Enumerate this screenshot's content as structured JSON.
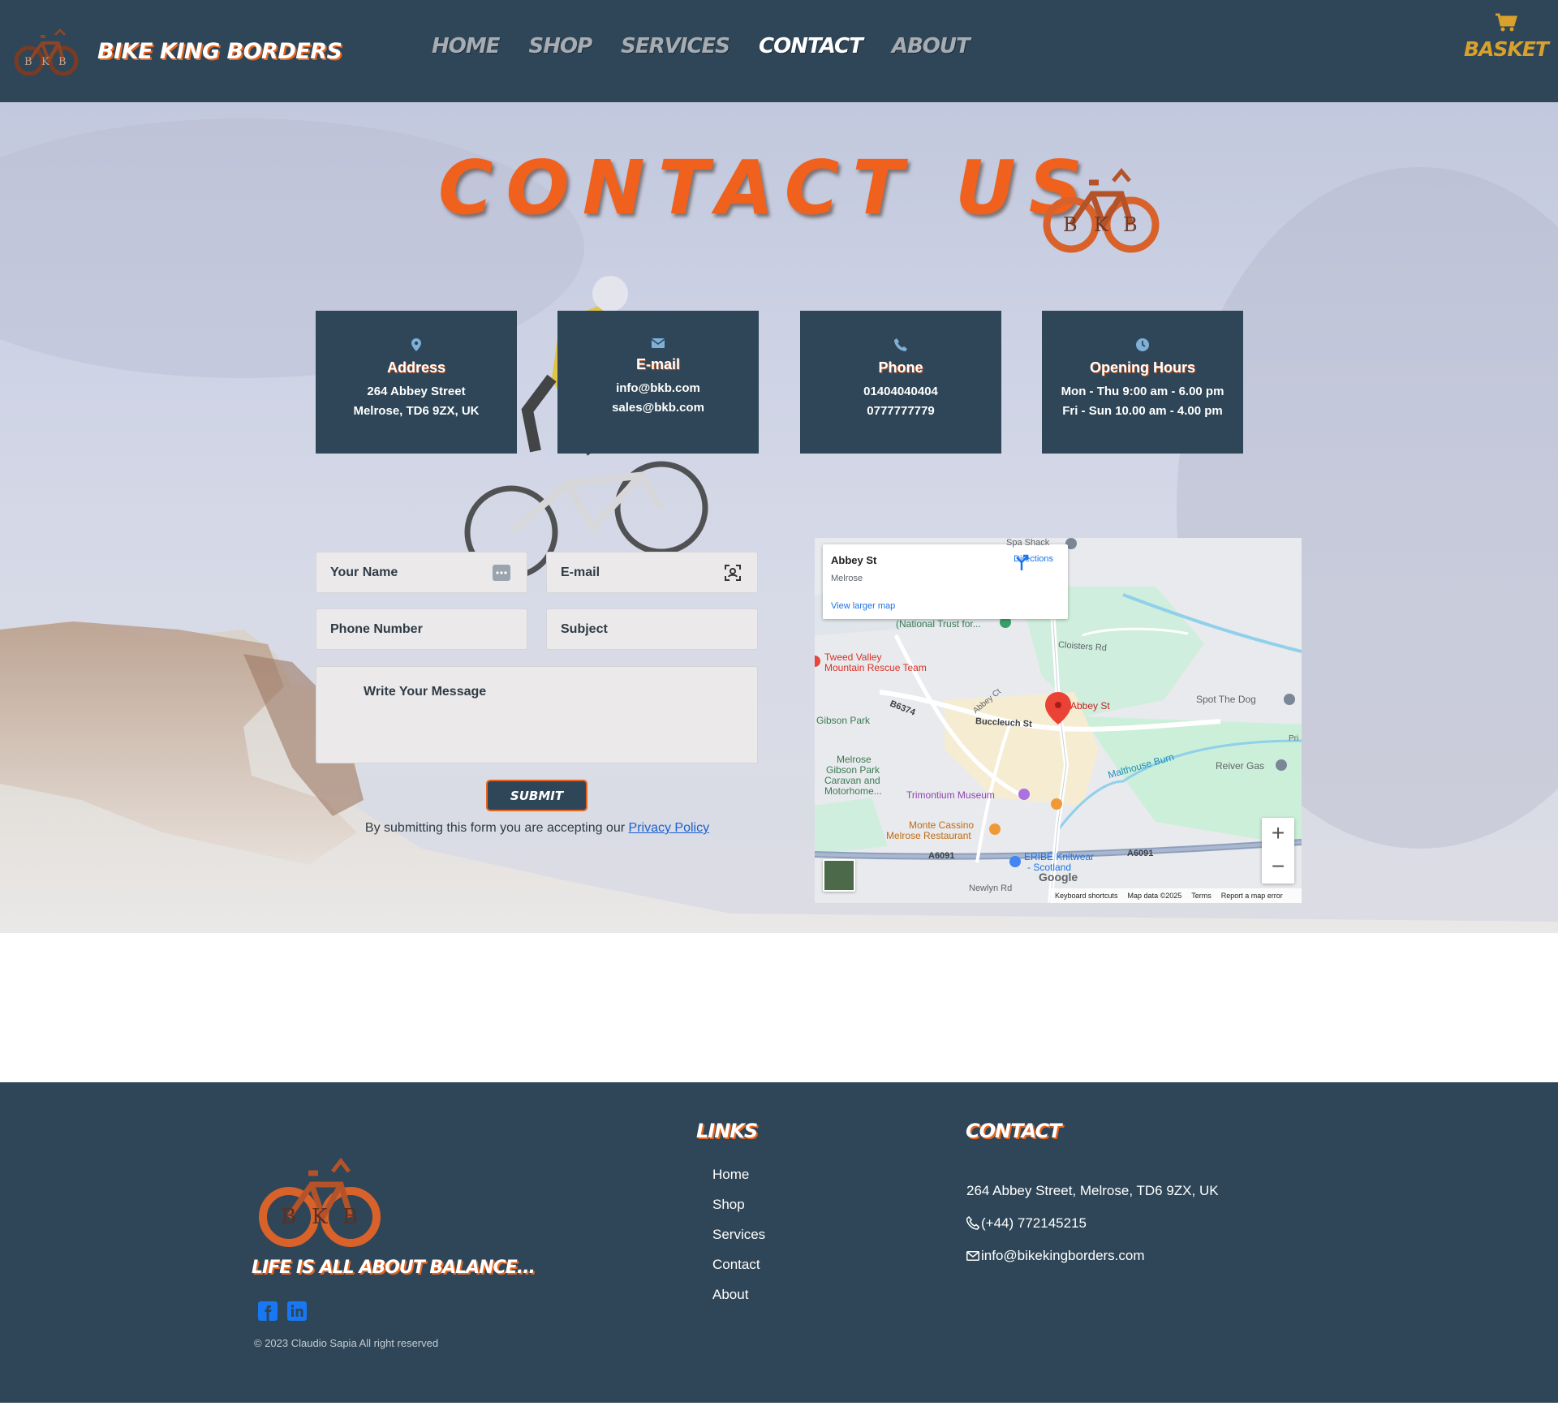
{
  "header": {
    "brand_name": "Bike King Borders",
    "nav": [
      "Home",
      "Shop",
      "Services",
      "Contact",
      "About"
    ],
    "active_nav": "Contact",
    "basket_label": "Basket"
  },
  "hero": {
    "title": "Contact Us"
  },
  "info_cards": [
    {
      "icon": "location-pin-icon",
      "title": "Address",
      "line1": "264 Abbey Street",
      "line2": "Melrose, TD6 9ZX, UK"
    },
    {
      "icon": "envelope-icon",
      "title": "E-mail",
      "line1": "info@bkb.com",
      "line2": "sales@bkb.com"
    },
    {
      "icon": "phone-icon",
      "title": "Phone",
      "line1": "01404040404",
      "line2": "0777777779"
    },
    {
      "icon": "clock-icon",
      "title": "Opening Hours",
      "line1": "Mon - Thu 9:00 am - 6.00 pm",
      "line2": "Fri - Sun 10.00 am - 4.00 pm"
    }
  ],
  "form": {
    "name_placeholder": "Your Name",
    "email_placeholder": "E-mail",
    "phone_placeholder": "Phone Number",
    "subject_placeholder": "Subject",
    "message_placeholder": "Write Your Message",
    "submit_label": "Submit",
    "consent_text": "By submitting this form you are accepting our",
    "privacy_link": "Privacy Policy"
  },
  "map": {
    "place_name": "Abbey St",
    "place_town": "Melrose",
    "directions_label": "Directions",
    "larger_map_label": "View larger map",
    "labels": {
      "spa_shack": "Spa Shack",
      "national_trust": "(National Trust for...",
      "tweed_valley_1": "Tweed Valley",
      "tweed_valley_2": "Mountain Rescue Team",
      "cloisters_rd": "Cloisters Rd",
      "spot_the_dog": "Spot The Dog",
      "b6374": "B6374",
      "abbey_ct": "Abbey Ct",
      "abbey_st_pin": "Abbey St",
      "gibson_park": "Gibson Park",
      "buccleuch_st": "Buccleuch St",
      "priory": "Pri",
      "reiver_gas": "Reiver Gas",
      "malthouse_burn": "Malthouse Burn",
      "caravan_1": "Melrose",
      "caravan_2": "Gibson Park",
      "caravan_3": "Caravan and",
      "caravan_4": "Motorhome...",
      "trimontium": "Trimontium Museum",
      "monte_cassino_1": "Monte Cassino",
      "monte_cassino_2": "Melrose Restaurant",
      "a6091_left": "A6091",
      "a6091_right": "A6091",
      "eribe_1": "ERIBÉ Knitwear",
      "eribe_2": "- Scotland",
      "newlyn_rd": "Newlyn Rd"
    },
    "google_label": "Google",
    "footer": {
      "shortcuts": "Keyboard shortcuts",
      "map_data": "Map data ©2025",
      "terms": "Terms",
      "report": "Report a map error"
    },
    "zoom_in": "+",
    "zoom_out": "−"
  },
  "footer": {
    "tagline": "Life is all about balance...",
    "copyright": "© 2023 Claudio Sapia All right reserved",
    "links_heading": "Links",
    "links": [
      "Home",
      "Shop",
      "Services",
      "Contact",
      "About"
    ],
    "contact_heading": "Contact",
    "address": "264 Abbey Street, Melrose, TD6 9ZX, UK",
    "phone": "(+44) 772145215",
    "email": "info@bikekingborders.com"
  },
  "colors": {
    "navy": "#2e4657",
    "orange": "#f0611e",
    "gold": "#d9a02c",
    "link_blue": "#1a5fd0"
  }
}
